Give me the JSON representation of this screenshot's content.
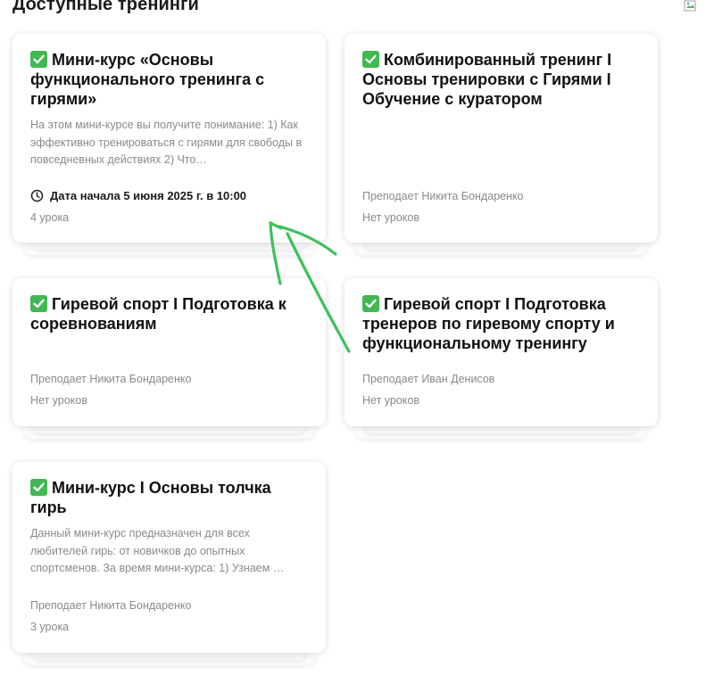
{
  "page": {
    "title": "Доступные тренинги"
  },
  "cards": [
    {
      "title": "Мини-курс «Основы функционального тренинга с гирями»",
      "description": "На этом мини-курсе вы получите понимание: 1) Как эффективно тренироваться с гирями для свободы в повседневных действиях 2) Что…",
      "start_date": "Дата начала 5 июня 2025 г. в 10:00",
      "lessons": "4 урока"
    },
    {
      "title": "Комбинированный тренинг I Основы тренировки с Гирями I Обучение с куратором",
      "teacher": "Преподает Никита Бондаренко",
      "lessons": "Нет уроков"
    },
    {
      "title": "Гиревой спорт I Подготовка к соревнованиям",
      "teacher": "Преподает Никита Бондаренко",
      "lessons": "Нет уроков"
    },
    {
      "title": "Гиревой спорт I Подготовка тренеров по гиревому спорту и функциональному тренингу",
      "teacher": "Преподает Иван Денисов",
      "lessons": "Нет уроков"
    },
    {
      "title": "Мини-курс I Основы толчка гирь",
      "description": "Данный мини-курс предназначен для всех любителей гирь: от новичков до опытных спортсменов. За время мини-курса: 1) Узнаем …",
      "teacher": "Преподает Никита Бондаренко",
      "lessons": "3 урока"
    }
  ],
  "icons": {
    "check": "check-mark-icon",
    "clock": "clock-icon",
    "image": "broken-image-icon"
  },
  "colors": {
    "check_bg": "#3fb950",
    "annotation_arrow": "#3cc25a",
    "muted_text": "#8a8a8a"
  }
}
